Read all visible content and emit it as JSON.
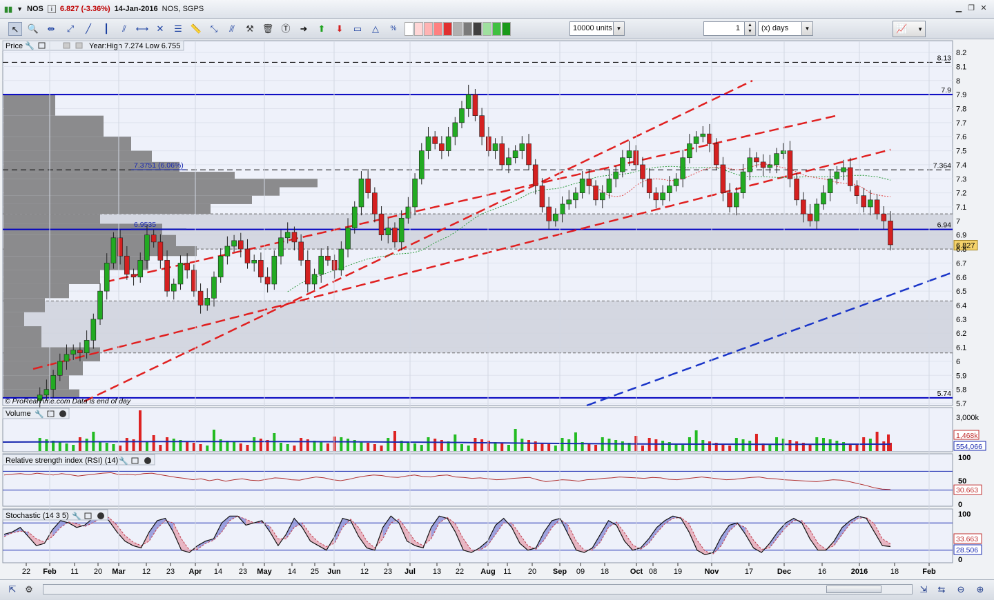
{
  "window": {
    "symbol": "NOS",
    "price_change": "6.827 (-3.36%)",
    "date": "14-Jan-2016",
    "name_exchange": "NOS, SGPS"
  },
  "toolbar": {
    "units_value": "10000 units",
    "period_value": "1",
    "period_unit": "(x) days"
  },
  "panels": {
    "price": {
      "label": "Price",
      "info": "Year:High 7.274 Low 6.755",
      "watermark": "© ProRealTime.com  Data is end of day"
    },
    "volume": {
      "label": "Volume"
    },
    "rsi": {
      "label": "Relative strength index (RSI) (14)"
    },
    "stoch": {
      "label": "Stochastic (14 3 5)"
    }
  },
  "chart_data": [
    {
      "type": "candlestick",
      "title": "NOS",
      "subtitle": "NOS, SGPS",
      "ylim": [
        5.65,
        8.25
      ],
      "y_ticks": [
        8.2,
        8.1,
        8,
        7.9,
        7.8,
        7.7,
        7.6,
        7.5,
        7.4,
        7.3,
        7.2,
        7.1,
        7,
        6.9,
        6.8,
        6.7,
        6.6,
        6.5,
        6.4,
        6.3,
        6.2,
        6.1,
        6,
        5.9,
        5.8,
        5.7
      ],
      "x_ticks": [
        "22",
        "Feb",
        "11",
        "20",
        "Mar",
        "12",
        "23",
        "Apr",
        "14",
        "23",
        "May",
        "14",
        "25",
        "Jun",
        "12",
        "23",
        "Jul",
        "13",
        "22",
        "Aug",
        "11",
        "20",
        "Sep",
        "09",
        "18",
        "Oct",
        "08",
        "19",
        "Nov",
        "17",
        "Dec",
        "16",
        "2016",
        "18",
        "Feb"
      ],
      "horizontal_lines": [
        {
          "label": "8.13",
          "value": 8.13,
          "style": "dashed",
          "color": "#000000"
        },
        {
          "label": "7.9",
          "value": 7.9,
          "style": "solid",
          "color": "#0000c0"
        },
        {
          "label": "7.364",
          "value": 7.364,
          "style": "dashed",
          "color": "#000000"
        },
        {
          "label": "6.94",
          "value": 6.94,
          "style": "solid",
          "color": "#0000c0"
        },
        {
          "label": "5.74",
          "value": 5.74,
          "style": "solid",
          "color": "#0000c0"
        }
      ],
      "annotations": [
        {
          "text": "7.3751 (6.06%)",
          "value": 7.3751
        },
        {
          "text": "6.9535",
          "value": 6.9535
        }
      ],
      "current_price_label": "6.827",
      "shaded_zones": [
        [
          6.8,
          7.05
        ],
        [
          6.06,
          6.43
        ]
      ],
      "colors": {
        "up": "#22aa22",
        "down": "#d42020",
        "channel": "#e02020",
        "trend": "#1a35c8",
        "ma_slow": "#2a9a3a",
        "ma_fast": "#e04040"
      },
      "series": [
        {
          "name": "close",
          "values": [
            5.72,
            5.76,
            5.8,
            5.9,
            6.0,
            6.05,
            6.08,
            6.06,
            6.15,
            6.3,
            6.5,
            6.7,
            6.88,
            6.75,
            6.62,
            6.6,
            6.72,
            6.9,
            6.85,
            6.72,
            6.5,
            6.55,
            6.7,
            6.65,
            6.5,
            6.4,
            6.45,
            6.6,
            6.75,
            6.82,
            6.86,
            6.8,
            6.7,
            6.72,
            6.6,
            6.55,
            6.75,
            6.88,
            6.92,
            6.85,
            6.72,
            6.55,
            6.62,
            6.75,
            6.72,
            6.65,
            6.8,
            6.95,
            7.1,
            7.3,
            7.2,
            7.05,
            6.9,
            6.95,
            6.85,
            7.02,
            7.1,
            7.3,
            7.5,
            7.6,
            7.55,
            7.5,
            7.6,
            7.7,
            7.8,
            7.9,
            7.75,
            7.6,
            7.5,
            7.55,
            7.4,
            7.45,
            7.5,
            7.55,
            7.4,
            7.25,
            7.1,
            7.0,
            7.05,
            7.12,
            7.15,
            7.2,
            7.3,
            7.25,
            7.15,
            7.2,
            7.3,
            7.35,
            7.45,
            7.5,
            7.4,
            7.3,
            7.2,
            7.15,
            7.2,
            7.25,
            7.3,
            7.45,
            7.55,
            7.6,
            7.62,
            7.55,
            7.4,
            7.2,
            7.1,
            7.2,
            7.35,
            7.45,
            7.42,
            7.38,
            7.4,
            7.48,
            7.5,
            7.3,
            7.15,
            7.05,
            7.0,
            7.12,
            7.2,
            7.3,
            7.35,
            7.38,
            7.25,
            7.18,
            7.1,
            7.15,
            7.05,
            7.0,
            6.83
          ]
        }
      ]
    },
    {
      "type": "bar",
      "title": "Volume",
      "y_ticks": [
        "3,000k",
        "0"
      ],
      "labels": [
        "1,468k",
        "554,066"
      ],
      "colors": {
        "up": "#22bb22",
        "down": "#dd2222",
        "ma": "#1a2ab0"
      }
    },
    {
      "type": "line",
      "title": "Relative strength index (RSI) (14)",
      "y_ticks": [
        100,
        50,
        0
      ],
      "ylim": [
        0,
        100
      ],
      "levels": [
        70,
        30
      ],
      "labels": [
        "30.663"
      ],
      "series": [
        {
          "name": "RSI",
          "values": [
            62,
            64,
            65,
            63,
            66,
            64,
            62,
            65,
            63,
            60,
            62,
            64,
            66,
            67,
            63,
            64,
            62,
            65,
            66,
            63,
            60,
            57,
            55,
            52,
            54,
            50,
            53,
            49,
            52,
            54,
            51,
            50,
            53,
            56,
            55,
            52,
            51,
            55,
            58,
            56,
            52,
            50,
            53,
            57,
            60,
            62,
            61,
            58,
            57,
            60,
            62,
            59,
            58,
            61,
            62,
            58,
            57,
            55,
            56,
            54,
            52,
            53,
            55,
            56,
            57,
            52,
            48,
            50,
            52,
            51,
            49,
            52,
            53,
            55,
            56,
            58,
            57,
            56,
            55,
            57,
            56,
            53,
            52,
            54,
            56,
            58,
            56,
            54,
            52,
            53,
            55,
            57,
            58,
            55,
            54,
            52,
            51,
            50,
            49,
            48,
            50,
            52,
            51,
            48,
            44,
            40,
            35,
            32,
            31
          ]
        }
      ]
    },
    {
      "type": "line",
      "title": "Stochastic (14 3 5)",
      "y_ticks": [
        100,
        50,
        0
      ],
      "ylim": [
        0,
        100
      ],
      "levels": [
        80,
        20
      ],
      "labels": [
        "33.663",
        "28.506"
      ],
      "series": [
        {
          "name": "%K",
          "values": [
            55,
            60,
            70,
            50,
            30,
            35,
            65,
            85,
            80,
            70,
            75,
            90,
            95,
            85,
            60,
            40,
            30,
            25,
            60,
            85,
            90,
            60,
            20,
            15,
            30,
            40,
            45,
            80,
            95,
            95,
            75,
            80,
            85,
            60,
            30,
            55,
            90,
            70,
            40,
            30,
            20,
            50,
            90,
            85,
            50,
            25,
            20,
            70,
            95,
            80,
            40,
            30,
            25,
            70,
            95,
            90,
            60,
            20,
            15,
            25,
            40,
            75,
            90,
            70,
            35,
            20,
            25,
            60,
            85,
            90,
            55,
            20,
            15,
            25,
            55,
            85,
            75,
            40,
            20,
            25,
            45,
            70,
            85,
            95,
            90,
            60,
            20,
            10,
            15,
            50,
            75,
            80,
            55,
            25,
            15,
            35,
            60,
            80,
            90,
            80,
            45,
            20,
            20,
            40,
            70,
            85,
            95,
            90,
            60,
            30,
            28
          ]
        },
        {
          "name": "%D",
          "values": [
            50,
            58,
            62,
            60,
            45,
            38,
            50,
            70,
            82,
            78,
            72,
            80,
            90,
            92,
            75,
            52,
            38,
            30,
            40,
            68,
            85,
            80,
            45,
            20,
            22,
            35,
            42,
            60,
            85,
            95,
            88,
            80,
            82,
            72,
            45,
            45,
            70,
            80,
            55,
            38,
            28,
            35,
            70,
            88,
            70,
            40,
            25,
            45,
            80,
            88,
            65,
            40,
            30,
            45,
            80,
            92,
            78,
            45,
            20,
            20,
            30,
            55,
            80,
            80,
            55,
            30,
            22,
            42,
            70,
            88,
            75,
            40,
            20,
            20,
            38,
            70,
            82,
            58,
            32,
            22,
            35,
            58,
            78,
            90,
            92,
            78,
            42,
            18,
            12,
            30,
            62,
            78,
            70,
            42,
            22,
            25,
            48,
            70,
            85,
            85,
            65,
            35,
            22,
            30,
            55,
            78,
            90,
            92,
            78,
            45,
            34
          ]
        }
      ]
    }
  ],
  "footer": {}
}
